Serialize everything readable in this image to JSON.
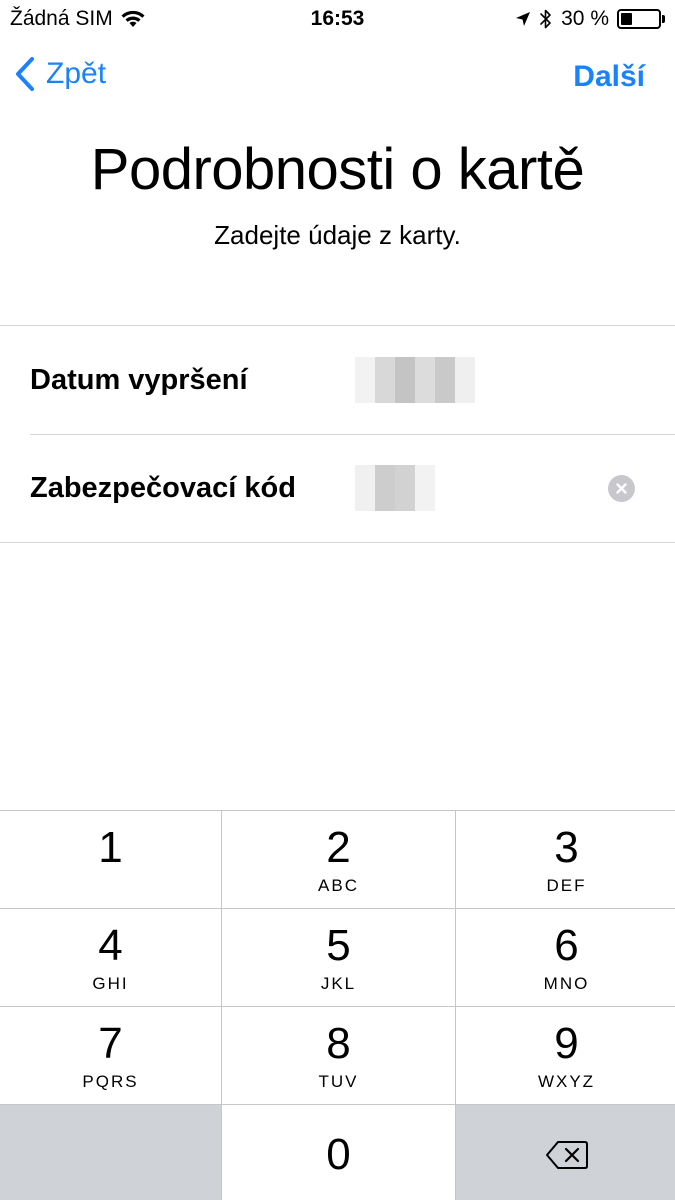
{
  "status_bar": {
    "carrier": "Žádná SIM",
    "time": "16:53",
    "battery_percent": "30 %",
    "battery_level": 0.3
  },
  "nav": {
    "back_label": "Zpět",
    "next_label": "Další"
  },
  "page": {
    "title": "Podrobnosti o kartě",
    "subtitle": "Zadejte údaje z karty."
  },
  "form": {
    "expiry_label": "Datum vypršení",
    "security_label": "Zabezpečovací kód"
  },
  "keypad": {
    "keys": [
      {
        "digit": "1",
        "letters": ""
      },
      {
        "digit": "2",
        "letters": "ABC"
      },
      {
        "digit": "3",
        "letters": "DEF"
      },
      {
        "digit": "4",
        "letters": "GHI"
      },
      {
        "digit": "5",
        "letters": "JKL"
      },
      {
        "digit": "6",
        "letters": "MNO"
      },
      {
        "digit": "7",
        "letters": "PQRS"
      },
      {
        "digit": "8",
        "letters": "TUV"
      },
      {
        "digit": "9",
        "letters": "WXYZ"
      },
      {
        "digit": "0",
        "letters": ""
      }
    ]
  },
  "colors": {
    "accent": "#1a82fb",
    "keypad_gray": "#cfd2d7"
  },
  "icons": [
    "wifi-icon",
    "location-arrow-icon",
    "bluetooth-icon",
    "battery-icon",
    "chevron-left-icon",
    "clear-icon",
    "delete-backspace-icon"
  ]
}
